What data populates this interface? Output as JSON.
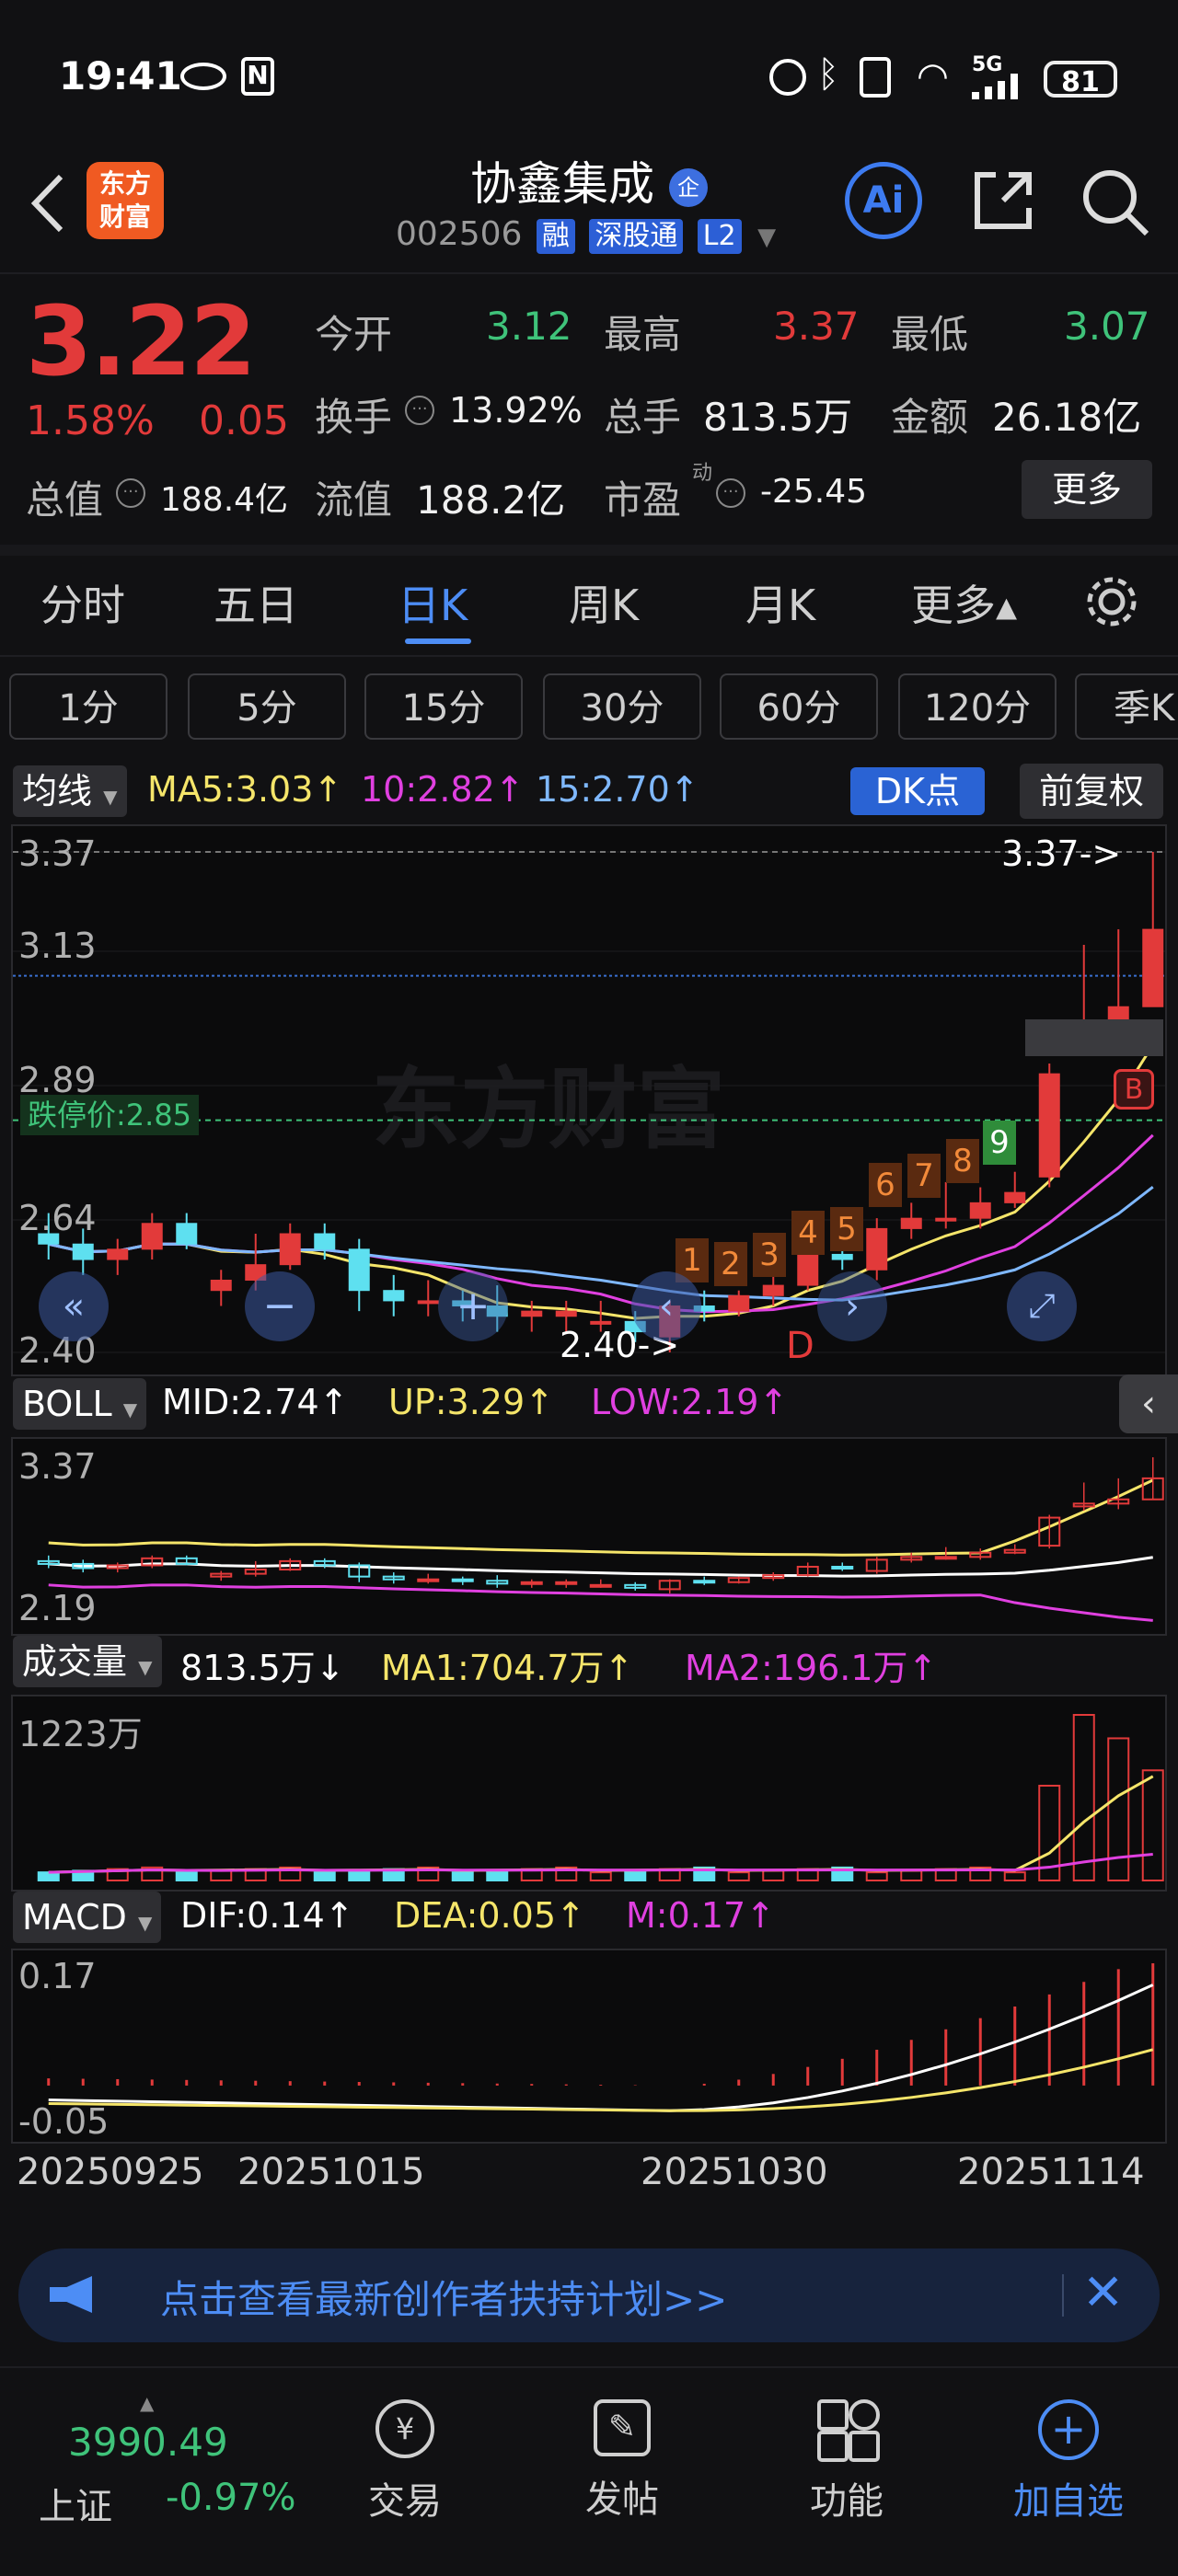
{
  "status_bar": {
    "time": "19:41",
    "battery": "81",
    "network": "5G"
  },
  "header": {
    "logo_text_1": "东方",
    "logo_text_2": "财富",
    "stock_name": "协鑫集成",
    "stock_badge": "企",
    "stock_code": "002506",
    "tags": [
      "融",
      "深股通",
      "L2"
    ]
  },
  "quote": {
    "price": "3.22",
    "change_pct": "1.58%",
    "change": "0.05",
    "open_label": "今开",
    "open": "3.12",
    "high_label": "最高",
    "high": "3.37",
    "low_label": "最低",
    "low": "3.07",
    "turnover_label": "换手",
    "turnover": "13.92%",
    "volume_label": "总手",
    "volume": "813.5万",
    "amount_label": "金额",
    "amount": "26.18亿",
    "mktcap_label": "总值",
    "mktcap": "188.4亿",
    "float_label": "流值",
    "float_cap": "188.2亿",
    "pe_label": "市盈",
    "pe_sup": "动",
    "pe": "-25.45",
    "more_button": "更多"
  },
  "tabs": [
    "分时",
    "五日",
    "日K",
    "周K",
    "月K",
    "更多▴"
  ],
  "periods": [
    "1分",
    "5分",
    "15分",
    "30分",
    "60分",
    "120分",
    "季K"
  ],
  "ma_bar": {
    "selector": "均线",
    "ma5": "MA5:3.03↑",
    "ma10": "10:2.82↑",
    "ma15": "15:2.70↑",
    "dk_button": "DK点",
    "adjust_button": "前复权"
  },
  "kline_axis": {
    "y_labels": [
      "3.37",
      "3.13",
      "2.89",
      "2.64",
      "2.40"
    ],
    "limit_down": "跌停价:2.85",
    "high_marker": "3.37->",
    "low_marker": "2.40->",
    "signal_b": "B",
    "signal_d": "D"
  },
  "seq_numbers": [
    "1",
    "2",
    "3",
    "4",
    "5",
    "6",
    "7",
    "8",
    "9"
  ],
  "watermark": "东方财富",
  "boll_bar": {
    "selector": "BOLL",
    "mid": "MID:2.74↑",
    "up": "UP:3.29↑",
    "low": "LOW:2.19↑",
    "y_top": "3.37",
    "y_bottom": "2.19"
  },
  "vol_bar": {
    "selector": "成交量",
    "vol": "813.5万↓",
    "ma1": "MA1:704.7万↑",
    "ma2": "MA2:196.1万↑",
    "y_top": "1223万"
  },
  "macd_bar": {
    "selector": "MACD",
    "dif": "DIF:0.14↑",
    "dea": "DEA:0.05↑",
    "m": "M:0.17↑",
    "y_top": "0.17",
    "y_bottom": "-0.05"
  },
  "x_dates": [
    "20250925",
    "20251015",
    "20251030",
    "20251114"
  ],
  "banner": {
    "text": "点击查看最新创作者扶持计划>>"
  },
  "bottom_nav": {
    "index_value": "3990.49",
    "index_name": "上证",
    "index_change": "-0.97%",
    "trade": "交易",
    "post": "发帖",
    "features": "功能",
    "add_watch": "加自选"
  },
  "colors": {
    "up": "#e23a3a",
    "down": "#5ee0f0",
    "accent": "#4d8df5",
    "ma5": "#f5e56a",
    "ma10": "#e040e0",
    "ma15": "#7fb8ff"
  },
  "chart_data": {
    "type": "candlestick",
    "description_dates": [
      "20250925",
      "20251015",
      "20251030",
      "20251114"
    ],
    "candles": [
      {
        "o": 2.63,
        "h": 2.67,
        "l": 2.58,
        "c": 2.61
      },
      {
        "o": 2.61,
        "h": 2.64,
        "l": 2.55,
        "c": 2.58
      },
      {
        "o": 2.58,
        "h": 2.62,
        "l": 2.55,
        "c": 2.6
      },
      {
        "o": 2.6,
        "h": 2.67,
        "l": 2.58,
        "c": 2.65
      },
      {
        "o": 2.65,
        "h": 2.67,
        "l": 2.6,
        "c": 2.61
      },
      {
        "o": 2.52,
        "h": 2.56,
        "l": 2.49,
        "c": 2.54
      },
      {
        "o": 2.54,
        "h": 2.63,
        "l": 2.52,
        "c": 2.57
      },
      {
        "o": 2.57,
        "h": 2.65,
        "l": 2.56,
        "c": 2.63
      },
      {
        "o": 2.63,
        "h": 2.65,
        "l": 2.58,
        "c": 2.6
      },
      {
        "o": 2.6,
        "h": 2.62,
        "l": 2.48,
        "c": 2.52
      },
      {
        "o": 2.52,
        "h": 2.55,
        "l": 2.47,
        "c": 2.5
      },
      {
        "o": 2.5,
        "h": 2.54,
        "l": 2.47,
        "c": 2.5
      },
      {
        "o": 2.5,
        "h": 2.52,
        "l": 2.46,
        "c": 2.49
      },
      {
        "o": 2.49,
        "h": 2.53,
        "l": 2.44,
        "c": 2.47
      },
      {
        "o": 2.47,
        "h": 2.5,
        "l": 2.44,
        "c": 2.48
      },
      {
        "o": 2.47,
        "h": 2.5,
        "l": 2.44,
        "c": 2.48
      },
      {
        "o": 2.46,
        "h": 2.5,
        "l": 2.44,
        "c": 2.46
      },
      {
        "o": 2.46,
        "h": 2.48,
        "l": 2.42,
        "c": 2.44
      },
      {
        "o": 2.43,
        "h": 2.5,
        "l": 2.4,
        "c": 2.49
      },
      {
        "o": 2.49,
        "h": 2.52,
        "l": 2.46,
        "c": 2.48
      },
      {
        "o": 2.48,
        "h": 2.52,
        "l": 2.47,
        "c": 2.51
      },
      {
        "o": 2.51,
        "h": 2.55,
        "l": 2.49,
        "c": 2.53
      },
      {
        "o": 2.53,
        "h": 2.62,
        "l": 2.52,
        "c": 2.59
      },
      {
        "o": 2.59,
        "h": 2.62,
        "l": 2.56,
        "c": 2.58
      },
      {
        "o": 2.56,
        "h": 2.66,
        "l": 2.54,
        "c": 2.64
      },
      {
        "o": 2.64,
        "h": 2.69,
        "l": 2.62,
        "c": 2.66
      },
      {
        "o": 2.66,
        "h": 2.73,
        "l": 2.64,
        "c": 2.66
      },
      {
        "o": 2.66,
        "h": 2.72,
        "l": 2.64,
        "c": 2.69
      },
      {
        "o": 2.69,
        "h": 2.75,
        "l": 2.68,
        "c": 2.71
      },
      {
        "o": 2.74,
        "h": 2.96,
        "l": 2.72,
        "c": 2.94
      },
      {
        "o": 3.02,
        "h": 3.19,
        "l": 2.99,
        "c": 3.04
      },
      {
        "o": 3.04,
        "h": 3.22,
        "l": 3.0,
        "c": 3.07
      },
      {
        "o": 3.07,
        "h": 3.37,
        "l": 3.07,
        "c": 3.22
      }
    ],
    "ylim": [
      2.4,
      3.37
    ],
    "ma5_last": 3.03,
    "ma10_last": 2.82,
    "ma15_last": 2.7
  }
}
